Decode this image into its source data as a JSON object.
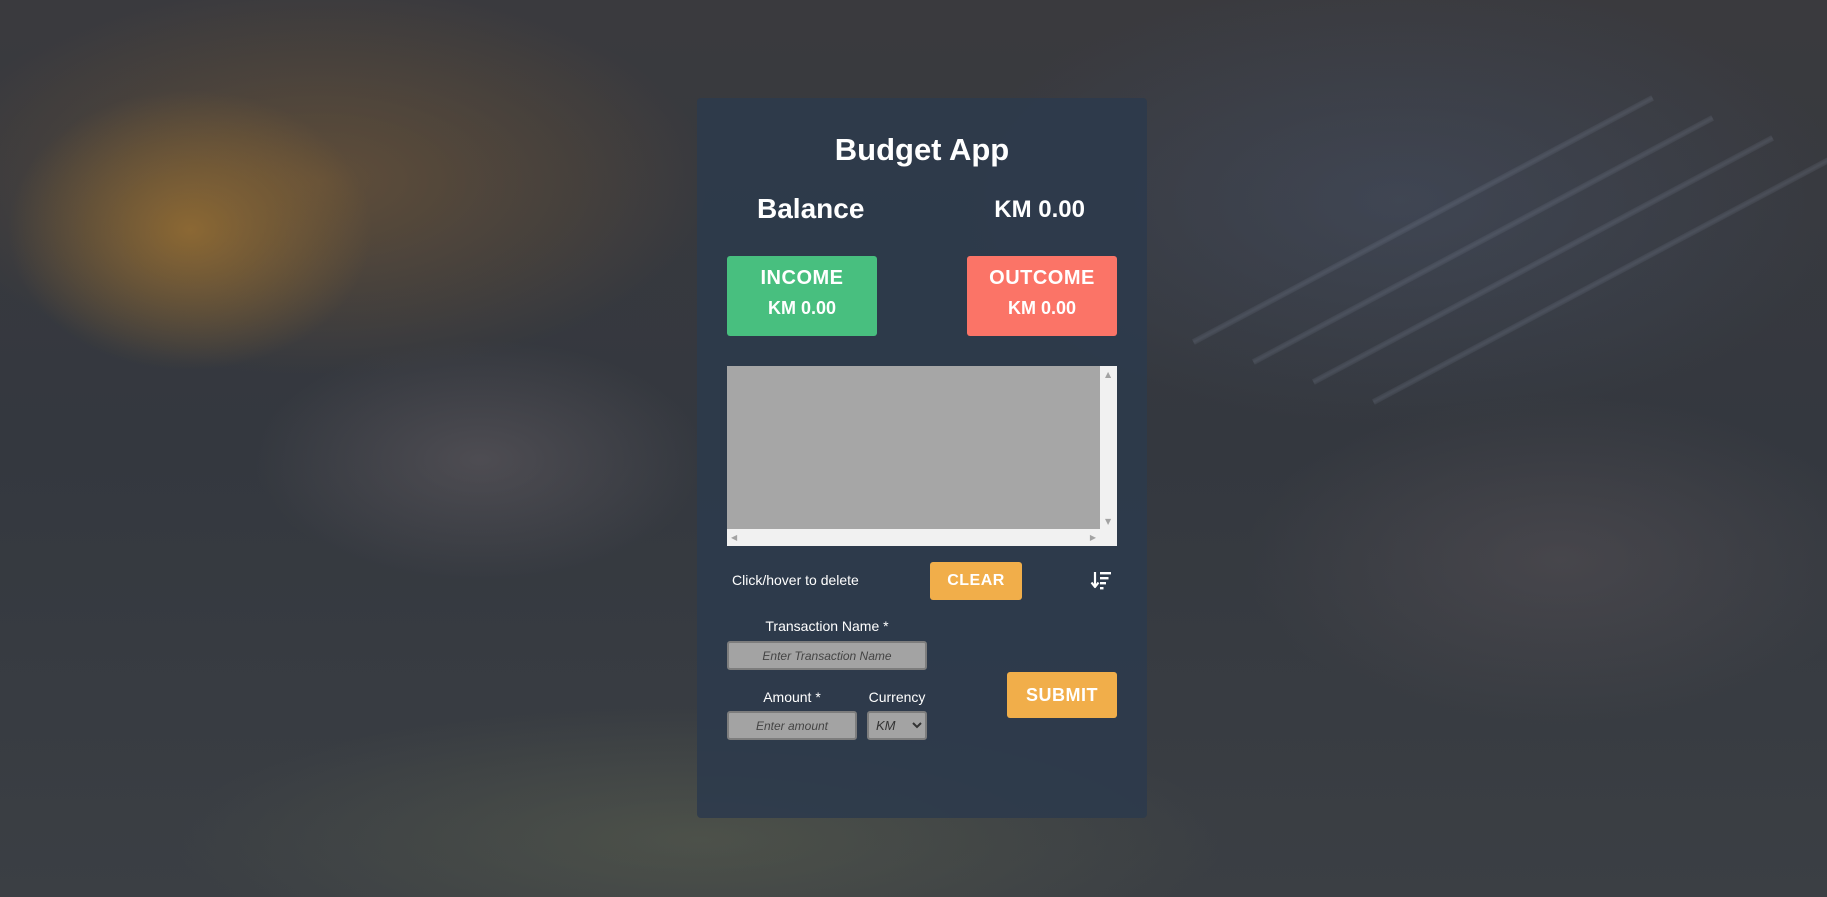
{
  "app": {
    "title": "Budget App"
  },
  "balance": {
    "label": "Balance",
    "value": "KM 0.00"
  },
  "income": {
    "label": "INCOME",
    "amount": "KM 0.00",
    "color": "#48bf7f"
  },
  "outcome": {
    "label": "OUTCOME",
    "amount": "KM 0.00",
    "color": "#fb7467"
  },
  "transactions": {
    "items": [],
    "hint": "Click/hover to delete",
    "clear_label": "CLEAR",
    "sort_icon": "sort-descending-icon"
  },
  "form": {
    "name_label": "Transaction Name *",
    "name_placeholder": "Enter Transaction Name",
    "name_value": "",
    "amount_label": "Amount *",
    "amount_placeholder": "Enter amount",
    "amount_value": "",
    "currency_label": "Currency",
    "currency_selected": "KM",
    "submit_label": "SUBMIT"
  },
  "colors": {
    "accent": "#f1ae4a",
    "panel": "#2c3a4c"
  }
}
